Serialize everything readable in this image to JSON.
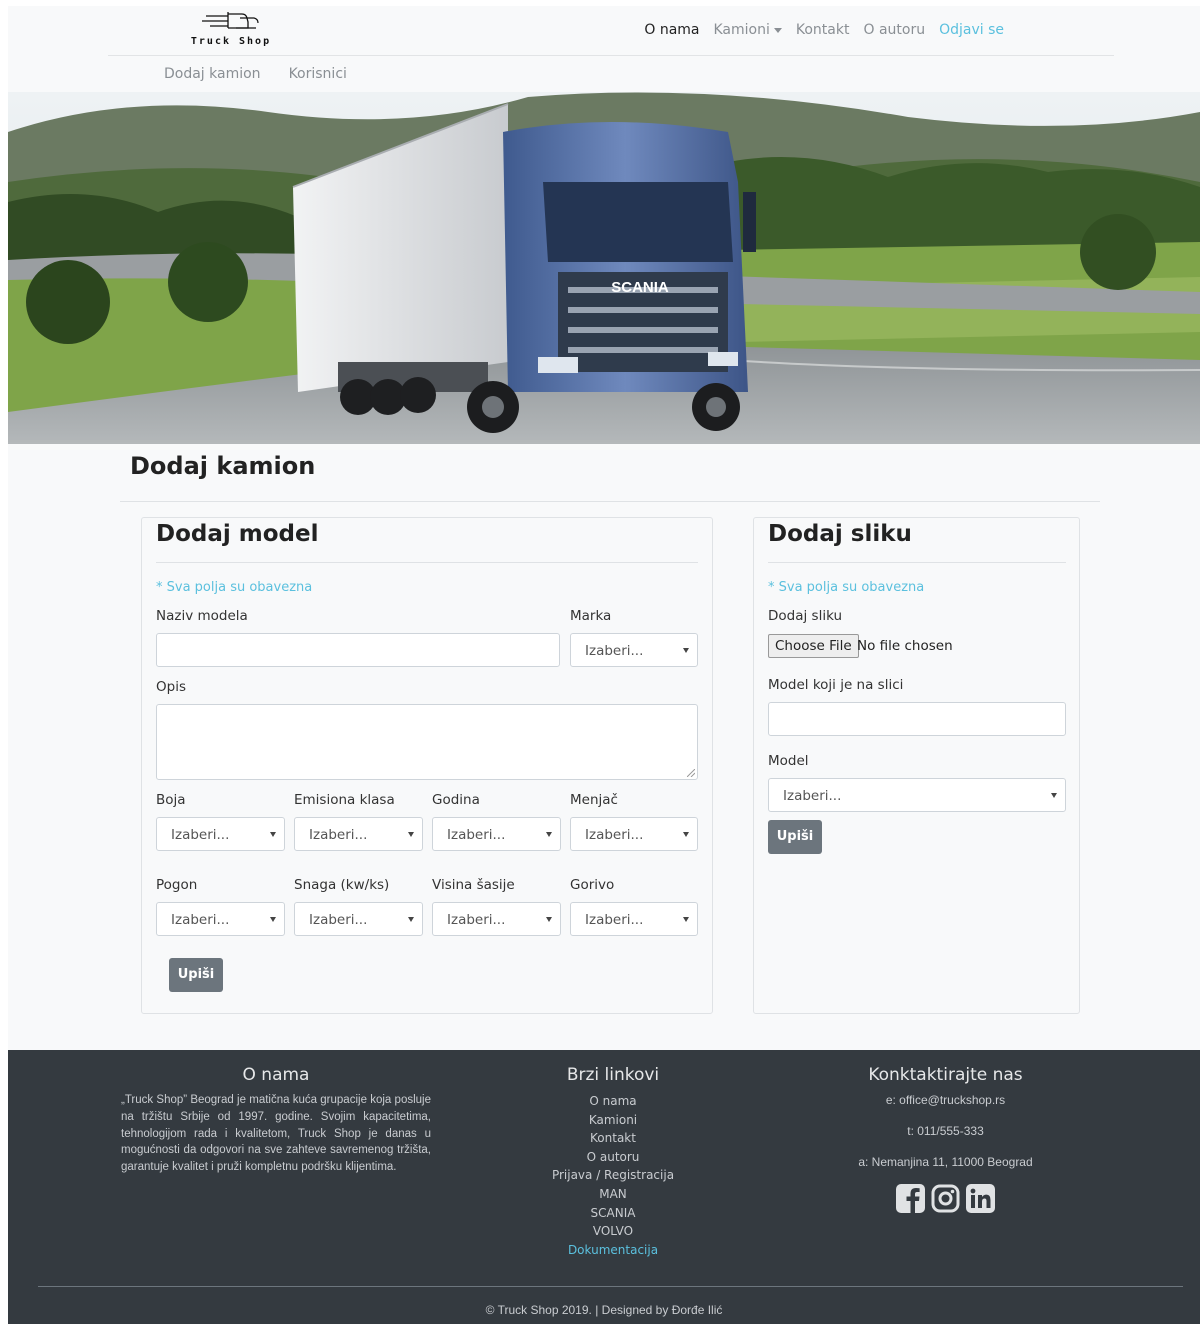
{
  "brand": {
    "name": "Truck Shop"
  },
  "nav": {
    "items": [
      {
        "label": "O nama",
        "active": true
      },
      {
        "label": "Kamioni",
        "dropdown": true
      },
      {
        "label": "Kontakt"
      },
      {
        "label": "O autoru"
      },
      {
        "label": "Odjavi se",
        "accent": true
      }
    ]
  },
  "subnav": {
    "items": [
      "Dodaj kamion",
      "Korisnici"
    ]
  },
  "hero": {
    "image": "scania-truck-on-road"
  },
  "page": {
    "title": "Dodaj kamion"
  },
  "model_form": {
    "title": "Dodaj model",
    "required_note": "* Sva polja su obavezna",
    "name_label": "Naziv modela",
    "brand_label": "Marka",
    "brand_value": "Izaberi...",
    "description_label": "Opis",
    "row1": [
      {
        "label": "Boja",
        "value": "Izaberi..."
      },
      {
        "label": "Emisiona klasa",
        "value": "Izaberi..."
      },
      {
        "label": "Godina",
        "value": "Izaberi..."
      },
      {
        "label": "Menjač",
        "value": "Izaberi..."
      }
    ],
    "row2": [
      {
        "label": "Pogon",
        "value": "Izaberi..."
      },
      {
        "label": "Snaga (kw/ks)",
        "value": "Izaberi..."
      },
      {
        "label": "Visina šasije",
        "value": "Izaberi..."
      },
      {
        "label": "Gorivo",
        "value": "Izaberi..."
      }
    ],
    "submit": "Upiši"
  },
  "image_form": {
    "title": "Dodaj sliku",
    "required_note": "* Sva polja su obavezna",
    "image_label": "Dodaj sliku",
    "choose_file": "Choose File",
    "no_file": "No file chosen",
    "model_on_image_label": "Model koji je na slici",
    "model_label": "Model",
    "model_value": "Izaberi...",
    "submit": "Upiši"
  },
  "footer": {
    "about_title": "O nama",
    "about_text": "„Truck Shop” Beograd je matična kuća grupacije koja posluje na tržištu Srbije od 1997. godine. Svojim kapacitetima, tehnologijom rada i kvalitetom, Truck Shop je danas u mogućnosti da odgovori na sve zahteve savremenog tržišta, garantuje kvalitet i pruži kompletnu podršku klijentima.",
    "links_title": "Brzi linkovi",
    "links": [
      "O nama",
      "Kamioni",
      "Kontakt",
      "O autoru",
      "Prijava / Registracija",
      "MAN",
      "SCANIA",
      "VOLVO",
      "Dokumentacija"
    ],
    "contact_title": "Konktaktirajte nas",
    "email": "e: office@truckshop.rs",
    "phone": "t: 011/555-333",
    "address": "a: Nemanjina 11, 11000 Beograd",
    "social_icons": [
      "facebook-icon",
      "instagram-icon",
      "linkedin-icon"
    ],
    "copyright": "© Truck Shop 2019. | Designed by Đorđe Ilić",
    "accent_color": "#5bc0de"
  }
}
